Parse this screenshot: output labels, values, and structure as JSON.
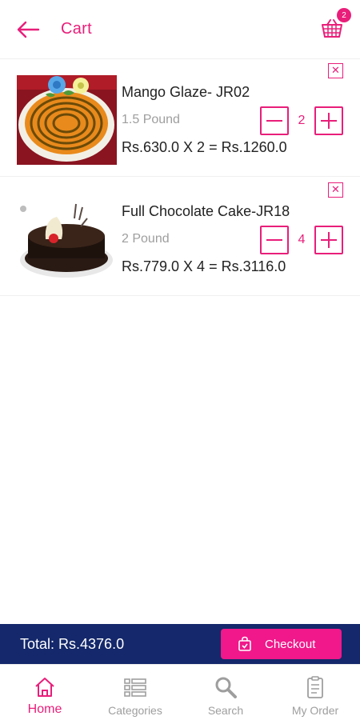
{
  "colors": {
    "accent": "#e91e7a",
    "navy": "#14286b",
    "checkout": "#f0188a",
    "muted": "#9e9e9e"
  },
  "header": {
    "title": "Cart",
    "cart_count": "2",
    "back_icon": "back-arrow-icon",
    "cart_icon": "basket-icon"
  },
  "items": [
    {
      "name": "Mango Glaze- JR02",
      "weight": "1.5 Pound",
      "quantity": "2",
      "price_line": "Rs.630.0 X 2 = Rs.1260.0",
      "image": "mango-glaze-cake-image"
    },
    {
      "name": "Full Chocolate Cake-JR18",
      "weight": "2 Pound",
      "quantity": "4",
      "price_line": "Rs.779.0 X 4 = Rs.3116.0",
      "image": "chocolate-cake-image"
    }
  ],
  "footer": {
    "total": "Total: Rs.4376.0",
    "checkout_label": "Checkout"
  },
  "nav": [
    {
      "label": "Home",
      "icon": "home-icon",
      "active": true
    },
    {
      "label": "Categories",
      "icon": "categories-icon",
      "active": false
    },
    {
      "label": "Search",
      "icon": "search-icon",
      "active": false
    },
    {
      "label": "My Order",
      "icon": "clipboard-icon",
      "active": false
    }
  ]
}
